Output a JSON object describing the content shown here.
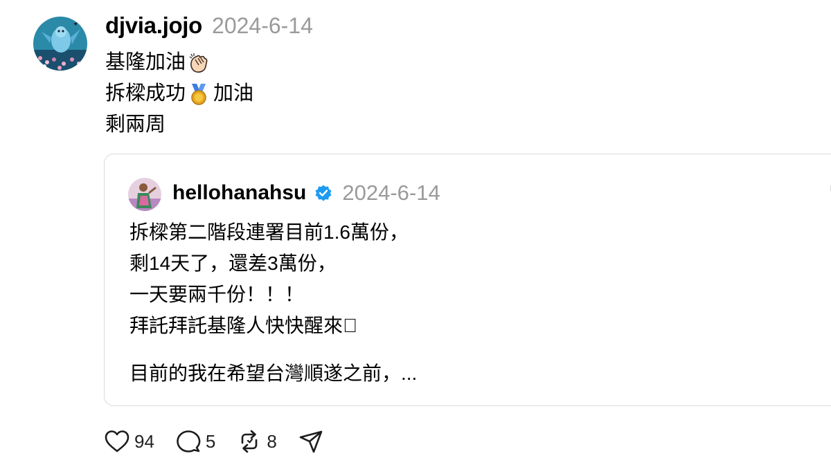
{
  "post": {
    "username": "djvia.jojo",
    "date": "2024-6-14",
    "lines": [
      {
        "text_before": "基隆加油",
        "emoji": "clapping-hands-icon",
        "text_after": ""
      },
      {
        "text_before": "拆樑成功",
        "emoji": "medal-icon",
        "text_after": " 加油"
      },
      {
        "text_before": "剩兩周",
        "emoji": "",
        "text_after": ""
      }
    ]
  },
  "quote": {
    "username": "hellohanahsu",
    "verified": true,
    "date": "2024-6-14",
    "lines": [
      "拆樑第二階段連署目前1.6萬份，",
      "剩14天了，還差3萬份，",
      "一天要兩千份！！！",
      "拜託拜託基隆人快快醒來􀀀"
    ],
    "truncated_line": "目前的我在希望台灣順遂之前，..."
  },
  "actions": {
    "likes": "94",
    "replies": "5",
    "reposts": "8",
    "like_icon": "heart-icon",
    "reply_icon": "comment-bubble-icon",
    "repost_icon": "repost-icon",
    "share_icon": "send-icon"
  },
  "colors": {
    "text": "#000000",
    "muted": "#9a9a9a",
    "border": "#d9d9d9",
    "verified": "#1d9bf0"
  }
}
